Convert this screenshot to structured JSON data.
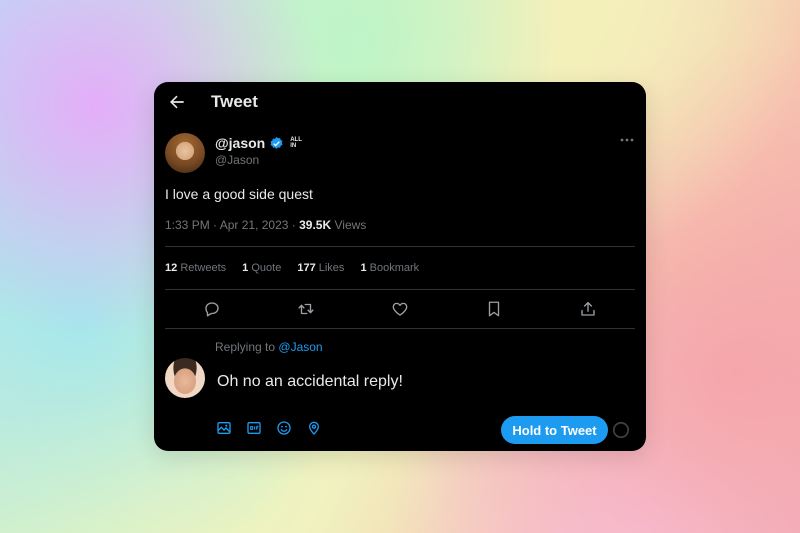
{
  "header": {
    "title": "Tweet"
  },
  "tweet": {
    "display_name": "@jason",
    "affiliation_badge": "ALL IN",
    "handle": "@Jason",
    "text": "I love a good side quest",
    "time": "1:33 PM",
    "date": "Apr 21, 2023",
    "views_count": "39.5K",
    "views_label": "Views"
  },
  "stats": {
    "retweets_count": "12",
    "retweets_label": "Retweets",
    "quotes_count": "1",
    "quotes_label": "Quote",
    "likes_count": "177",
    "likes_label": "Likes",
    "bookmarks_count": "1",
    "bookmarks_label": "Bookmark"
  },
  "actions": [
    "reply-icon",
    "retweet-icon",
    "like-icon",
    "bookmark-icon",
    "share-icon"
  ],
  "reply": {
    "replying_to_label": "Replying to",
    "replying_to_handle": "@Jason",
    "text": "Oh no an accidental reply!",
    "toolbar_icons": [
      "image-icon",
      "gif-icon",
      "emoji-icon",
      "location-icon"
    ],
    "button_label": "Hold to Tweet"
  },
  "colors": {
    "accent": "#1d9bf0",
    "background": "#000000",
    "text_primary": "#e7e9ea",
    "text_secondary": "#71767b",
    "divider": "#2f3336"
  }
}
